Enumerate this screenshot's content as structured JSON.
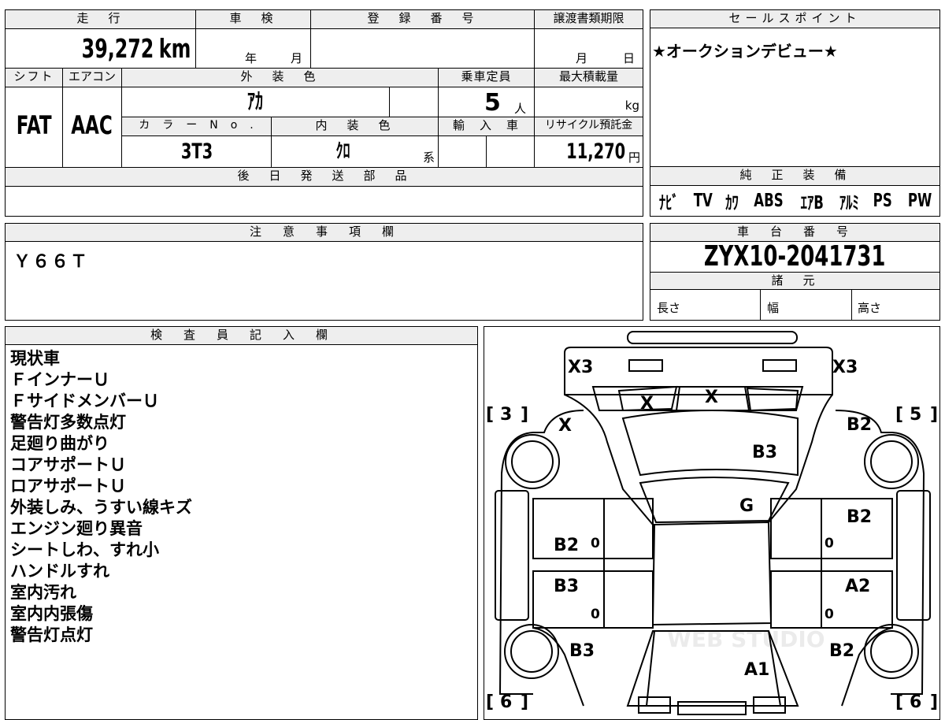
{
  "top_left": {
    "mileage_label": "走　行",
    "mileage_value": "39,272",
    "mileage_unit": "km",
    "inspection_label": "車　検",
    "inspection_year_unit": "年",
    "inspection_month_unit": "月",
    "registration_label": "登　録　番　号",
    "transfer_deadline_label": "譲渡書類期限",
    "transfer_month_unit": "月",
    "transfer_day_unit": "日",
    "shift_label": "シフト",
    "shift_value": "FAT",
    "aircon_label": "エアコン",
    "aircon_value": "AAC",
    "exterior_color_label": "外　装　色",
    "exterior_color_value": "ｱｶ",
    "capacity_label": "乗車定員",
    "capacity_value": "5",
    "capacity_unit": "人",
    "max_load_label": "最大積載量",
    "max_load_unit": "kg",
    "color_no_label": "カ　ラ　ー　N　o　.",
    "color_no_value": "3T3",
    "interior_color_label": "内　装　色",
    "interior_color_value": "ｸﾛ",
    "interior_color_suffix": "系",
    "import_label": "輸　入　車",
    "recycle_label": "リサイクル預託金",
    "recycle_value": "11,270",
    "recycle_unit": "円",
    "later_parts_label": "後　日　発　送　部　品"
  },
  "sales_point": {
    "label": "セールスポイント",
    "text": "★オークションデビュー★"
  },
  "equipment": {
    "label": "純　正　装　備",
    "items": [
      "ﾅﾋﾞ",
      "TV",
      "ｶﾜ",
      "ABS",
      "ｴｱB",
      "ｱﾙﾐ",
      "PS",
      "PW"
    ]
  },
  "notes": {
    "label": "注　意　事　項　欄",
    "text": "Ｙ６６Ｔ"
  },
  "chassis": {
    "label": "車　台　番　号",
    "value": "ZYX10-2041731",
    "spec_label": "諸　元",
    "length_label": "長さ",
    "width_label": "幅",
    "height_label": "高さ"
  },
  "inspector": {
    "label": "検　査　員　記　入　欄",
    "remarks": [
      "現状車",
      "ＦインナーＵ",
      "ＦサイドメンバーＵ",
      "警告灯多数点灯",
      "足廻り曲がり",
      "コアサポートＵ",
      "ロアサポートＵ",
      "外装しみ、うすい線キズ",
      "エンジン廻り異音",
      "シートしわ、すれ小",
      "ハンドルすれ",
      "室内汚れ",
      "室内内張傷",
      "警告灯点灯"
    ]
  },
  "diagram": {
    "codes": {
      "front_left_corner": "X3",
      "front_right_corner": "X3",
      "windshield_left": "X",
      "windshield_center": "X",
      "left_front_fender": "X",
      "right_front_fender": "B2",
      "hood": "B3",
      "roof_front": "G",
      "left_front_door": "B2",
      "right_front_door": "B2",
      "left_rear_door": "B3",
      "right_rear_door": "A2",
      "left_rear_fender": "B3",
      "right_rear_fender": "B2",
      "rear": "A1"
    },
    "tire_labels": {
      "front_left": "3",
      "front_right": "5",
      "rear_left": "6",
      "rear_right": "6"
    },
    "zero_marks": "0",
    "watermark": "WEB STUDIO"
  }
}
